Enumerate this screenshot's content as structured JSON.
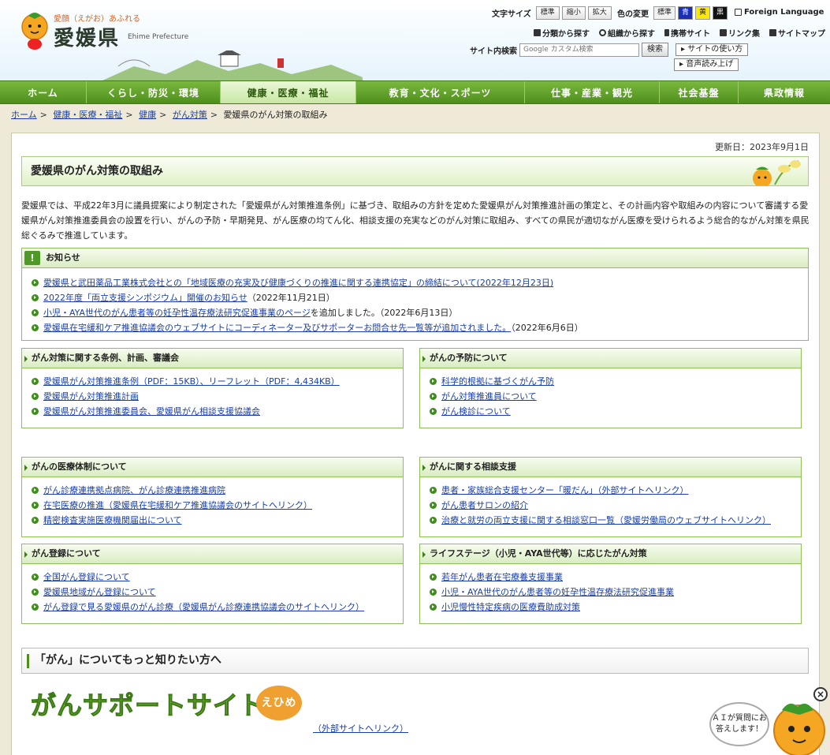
{
  "header": {
    "tagline": "愛顔（えがお）あふれる",
    "site_name": "愛媛県",
    "site_name_en": "Ehime Prefecture",
    "font_size_label": "文字サイズ",
    "font_buttons": [
      "標準",
      "縮小",
      "拡大"
    ],
    "color_label": "色の変更",
    "color_buttons": [
      {
        "label": "標準",
        "bg": "#f2f2f2",
        "fg": "#222222"
      },
      {
        "label": "青",
        "bg": "#1a2fb8",
        "fg": "#ffffff"
      },
      {
        "label": "黄",
        "bg": "#ffe800",
        "fg": "#222222"
      },
      {
        "label": "黒",
        "bg": "#111111",
        "fg": "#ffffff"
      }
    ],
    "foreign_language": "Foreign Language",
    "nav_links": [
      "分類から探す",
      "組織から探す",
      "携帯サイト",
      "リンク集",
      "サイトマップ"
    ],
    "search_label": "サイト内検索",
    "search_placeholder": "Google カスタム検索",
    "search_button": "検索",
    "how_to_use": "サイトの使い方",
    "read_aloud": "音声読み上げ"
  },
  "global_nav": [
    {
      "label": "ホーム",
      "active": false
    },
    {
      "label": "くらし・防災・環境",
      "active": false
    },
    {
      "label": "健康・医療・福祉",
      "active": true
    },
    {
      "label": "教育・文化・スポーツ",
      "active": false
    },
    {
      "label": "仕事・産業・観光",
      "active": false
    },
    {
      "label": "社会基盤",
      "active": false
    },
    {
      "label": "県政情報",
      "active": false
    }
  ],
  "breadcrumb": {
    "links": [
      "ホーム",
      "健康・医療・福祉",
      "健康",
      "がん対策"
    ],
    "current": "愛媛県のがん対策の取組み"
  },
  "page": {
    "updated": "更新日：2023年9月1日",
    "title": "愛媛県のがん対策の取組み",
    "intro": "愛媛県では、平成22年3月に議員提案により制定された「愛媛県がん対策推進条例」に基づき、取組みの方針を定めた愛媛県がん対策推進計画の策定と、その計画内容や取組みの内容について審議する愛媛県がん対策推進委員会の設置を行い、がんの予防・早期発見、がん医療の均てん化、相談支援の充実などのがん対策に取組み、すべての県民が適切ながん医療を受けられるよう総合的ながん対策を県民総ぐるみで推進しています。"
  },
  "notice": {
    "title": "お知らせ",
    "items": [
      {
        "link": "愛媛県と武田薬品工業株式会社との「地域医療の充実及び健康づくりの推進に関する連携協定」の締結について(2022年12月23日)",
        "after": ""
      },
      {
        "link": "2022年度「両立支援シンポジウム」開催のお知らせ",
        "after": "（2022年11月21日）"
      },
      {
        "link": "小児・AYA世代のがん患者等の妊孕性温存療法研究促進事業のページ",
        "after": "を追加しました。（2022年6月13日）"
      },
      {
        "link": "愛媛県在宅緩和ケア推進協議会のウェブサイトにコーディネーター及びサポーターお問合せ先一覧等が追加されました。",
        "after": "（2022年6月6日）"
      }
    ]
  },
  "sections": [
    {
      "title": "がん対策に関する条例、計画、審議会",
      "items": [
        "愛媛県がん対策推進条例（PDF：15KB）、リーフレット（PDF：4,434KB）",
        "愛媛県がん対策推進計画",
        "愛媛県がん対策推進委員会、愛媛県がん相談支援協議会"
      ]
    },
    {
      "title": "がんの予防について",
      "items": [
        "科学的根拠に基づくがん予防",
        "がん対策推進員について",
        "がん検診について"
      ]
    },
    {
      "title": "がんの医療体制について",
      "items": [
        "がん診療連携拠点病院、がん診療連携推進病院",
        "在宅医療の推進（愛媛県在宅緩和ケア推進協議会のサイトへリンク）",
        "精密検査実施医療機関届出について"
      ]
    },
    {
      "title": "がんに関する相談支援",
      "items": [
        "患者・家族総合支援センター「暖だん」（外部サイトへリンク）",
        "がん患者サロンの紹介",
        "治療と就労の両立支援に関する相談窓口一覧（愛媛労働局のウェブサイトへリンク）"
      ]
    },
    {
      "title": "がん登録について",
      "items": [
        "全国がん登録について",
        "愛媛県地域がん登録について",
        "がん登録で見る愛媛県のがん診療（愛媛県がん診療連携協議会のサイトへリンク）"
      ]
    },
    {
      "title": "ライフステージ（小児・AYA世代等）に応じたがん対策",
      "items": [
        "若年がん患者在宅療養支援事業",
        "小児・AYA世代のがん患者等の妊孕性温存療法研究促進事業",
        "小児慢性特定疾病の医療費助成対策"
      ]
    }
  ],
  "more": {
    "heading": "「がん」についてもっと知りたい方へ",
    "logo_text": "がんサポートサイト",
    "logo_badge": "えひめ",
    "link": "（外部サイトへリンク）"
  },
  "ai_chat": {
    "text": "ＡＩが質問にお答えします！",
    "close": "×"
  }
}
